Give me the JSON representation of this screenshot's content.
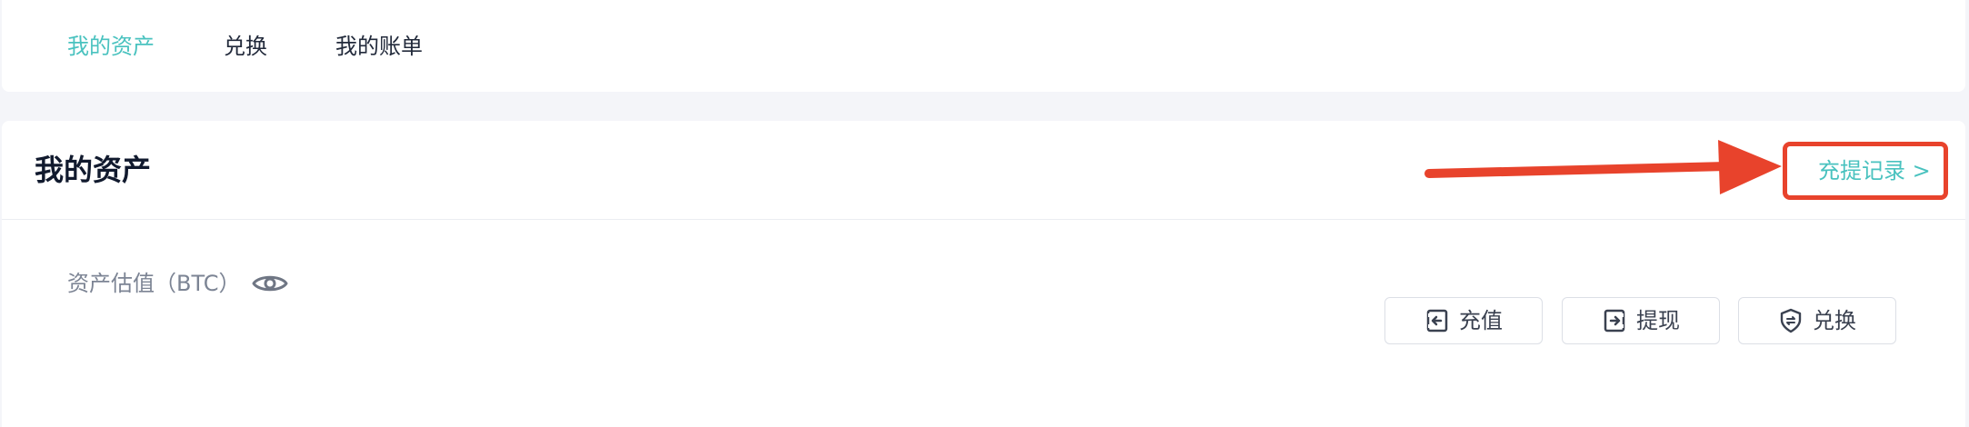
{
  "tabs": [
    {
      "label": "我的资产",
      "active": true
    },
    {
      "label": "兑换",
      "active": false
    },
    {
      "label": "我的账单",
      "active": false
    }
  ],
  "main": {
    "title": "我的资产",
    "record_link": "充提记录 >",
    "valuation_label": "资产估值（BTC）"
  },
  "actions": {
    "deposit": {
      "label": "充值",
      "icon": "deposit-icon"
    },
    "withdraw": {
      "label": "提现",
      "icon": "withdraw-icon"
    },
    "exchange": {
      "label": "兑换",
      "icon": "exchange-shield-icon"
    }
  },
  "colors": {
    "accent": "#49c2bf",
    "annotation": "#e8432c",
    "page_background": "#f4f5f9",
    "title": "#111a2e"
  },
  "icons": {
    "visibility": "eye-icon",
    "annotation": "red-arrow-annotation"
  }
}
